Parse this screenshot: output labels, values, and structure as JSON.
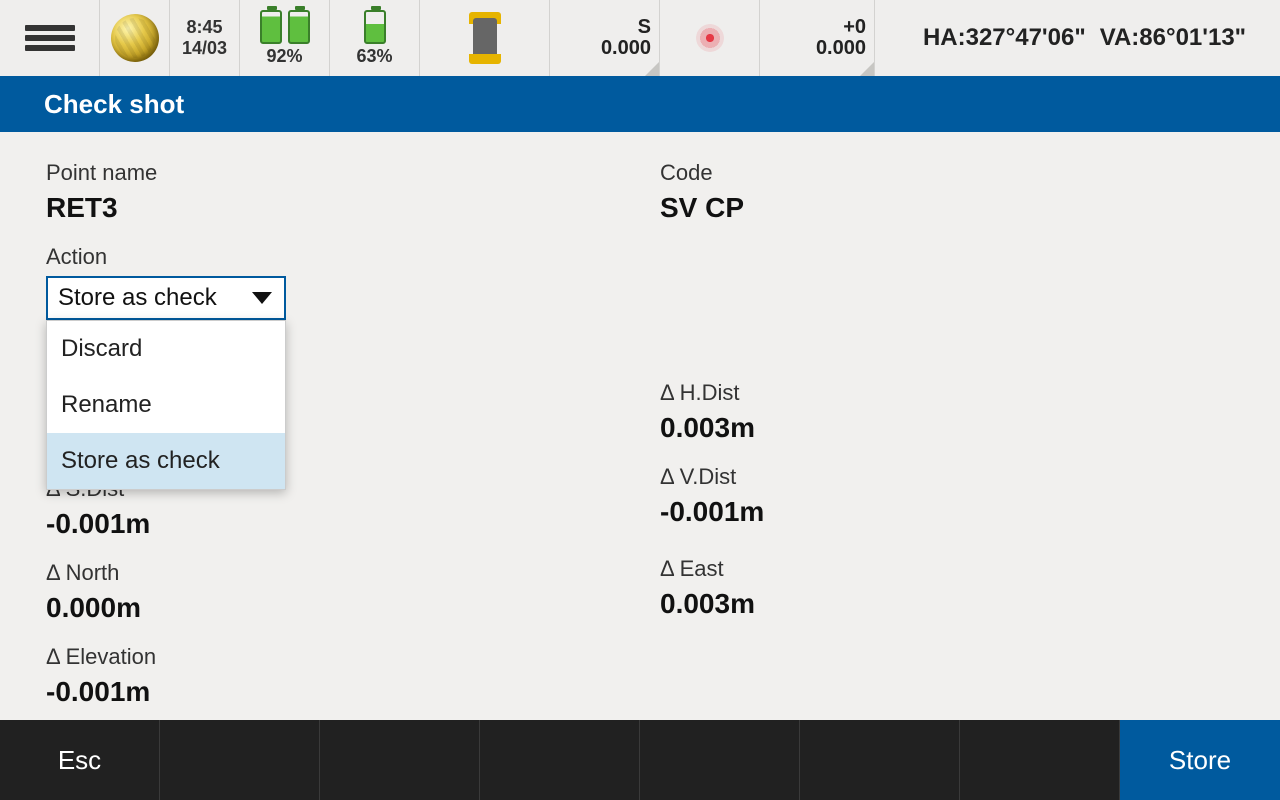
{
  "topbar": {
    "time": "8:45",
    "date": "14/03",
    "battery1_pct": "92%",
    "battery2_pct": "63%",
    "s_label": "S",
    "s_value": "0.000",
    "zero_label": "+0",
    "zero_value": "0.000",
    "ha": "HA:327°47'06\"",
    "va": "VA:86°01'13\""
  },
  "title": "Check shot",
  "fields": {
    "point_name_label": "Point name",
    "point_name_value": "RET3",
    "code_label": "Code",
    "code_value": "SV CP",
    "action_label": "Action",
    "action_value": "Store as check",
    "action_options": {
      "0": "Discard",
      "1": "Rename",
      "2": "Store as check"
    },
    "dhdist_label": "Δ H.Dist",
    "dhdist_value": "0.003m",
    "dvdist_label": "Δ V.Dist",
    "dvdist_value": "-0.001m",
    "dsdist_label": "Δ S.Dist",
    "dsdist_value": "-0.001m",
    "dnorth_label": "Δ North",
    "dnorth_value": "0.000m",
    "deast_label": "Δ East",
    "deast_value": "0.003m",
    "delev_label": "Δ Elevation",
    "delev_value": "-0.001m"
  },
  "bottom": {
    "esc": "Esc",
    "store": "Store"
  }
}
